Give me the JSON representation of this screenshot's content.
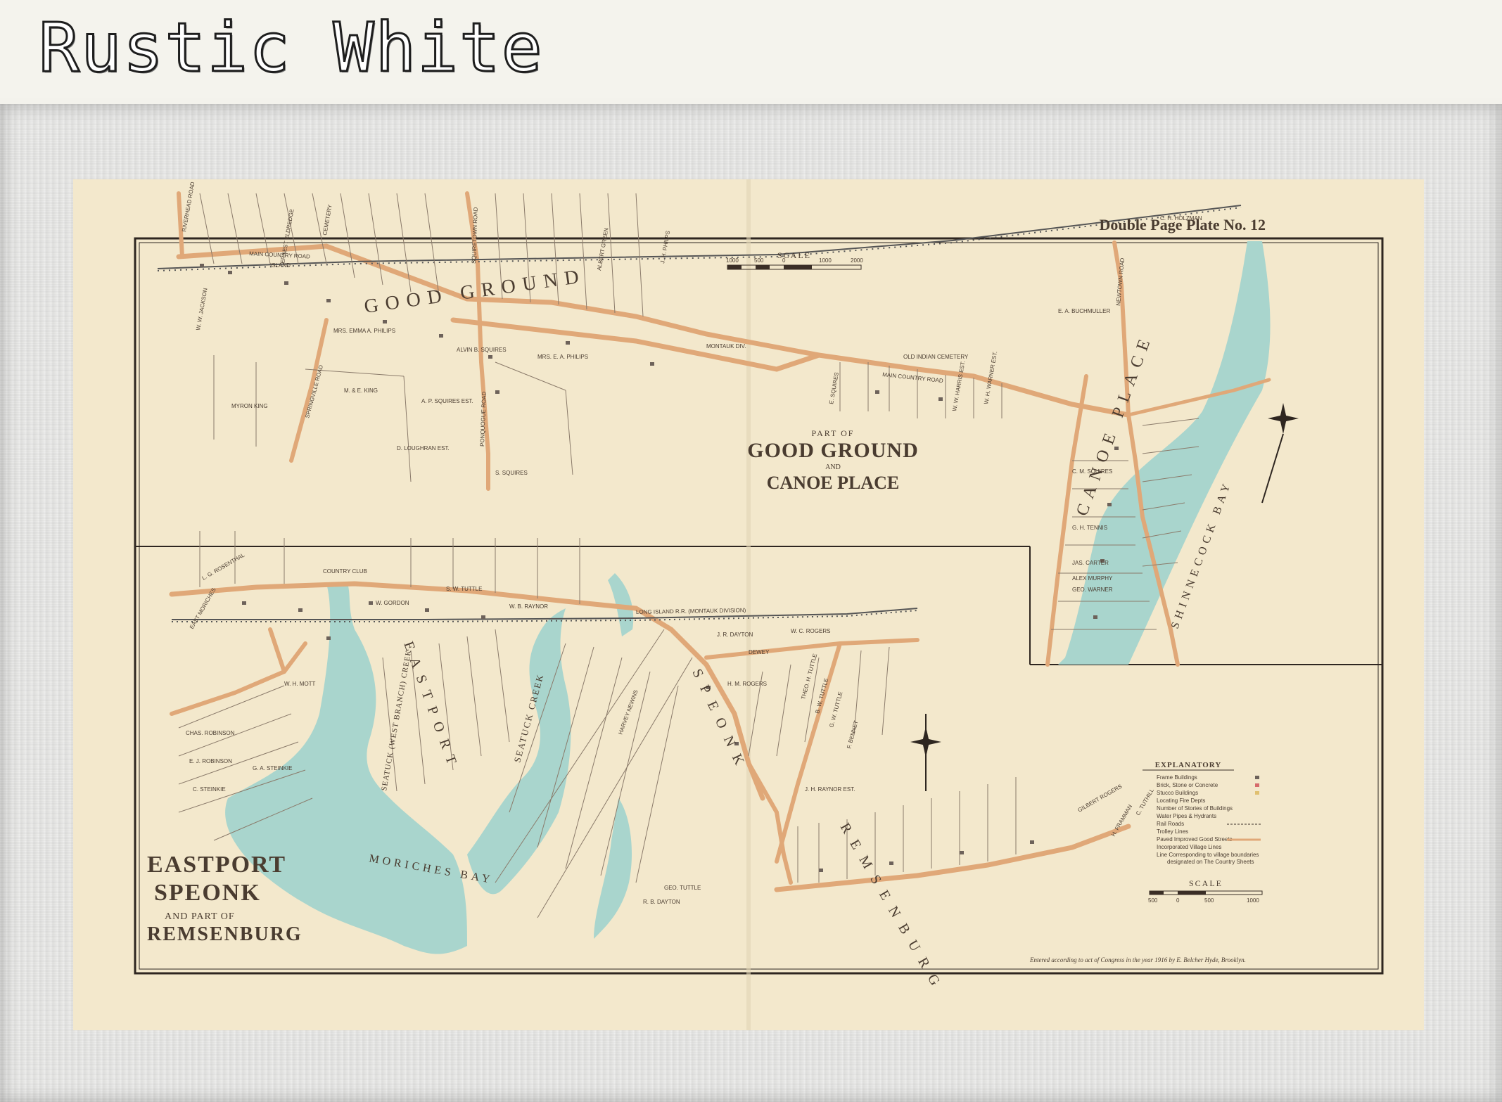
{
  "header": {
    "title": "Rustic White"
  },
  "map": {
    "plate_title": "Double Page Plate No. 12",
    "scale_label": "SCALE",
    "top_scale_ticks": [
      "1000",
      "500",
      "0",
      "1000",
      "2000"
    ],
    "bottom_scale_ticks": [
      "500",
      "0",
      "500",
      "1000"
    ],
    "part_of_label": "PART OF",
    "good_ground_title": "GOOD GROUND",
    "and_label": "AND",
    "canoe_place_title": "CANOE PLACE",
    "lower_title_1": "EASTPORT",
    "lower_title_2": "SPEONK",
    "lower_and_part_of": "AND PART OF",
    "lower_title_3": "REMSENBURG",
    "places": {
      "good_ground": "GOOD GROUND",
      "canoe_place": "CANOE PLACE",
      "shinnecock_bay": "SHINNECOCK BAY",
      "moriches_bay": "MORICHES BAY",
      "seatuck_creek": "SEATUCK CREEK",
      "seatuck_west": "SEATUCK (WEST BRANCH) CREEK",
      "eastport": "EASTPORT",
      "speonk": "SPEONK",
      "remsenburg": "REMSENBURG"
    },
    "roads": {
      "main_country_road": "MAIN COUNTRY ROAD",
      "riverhead_road": "RIVERHEAD ROAD",
      "squiretown_road": "SQUIRETOWN ROAD",
      "ponquogue_road": "PONQUOGUE ROAD",
      "springville_road": "SPRINGVILLE ROAD",
      "newtown_road": "NEWTOWN ROAD",
      "long_island_rr": "LONG ISLAND R.R. (MONTAUK DIVISION)",
      "island": "ISLAND",
      "montauk_div": "MONTAUK DIV.",
      "old_indian_cemetery": "OLD INDIAN CEMETERY",
      "cemetery": "CEMETERY",
      "country_club": "COUNTRY CLUB",
      "dewey": "DEWEY",
      "east_moriches": "EAST MORICHES"
    },
    "owners_top": [
      "W. W. JACKSON",
      "MRS. EMMA A. PHILIPS",
      "ALVIN B. SQUIRES",
      "MYRON KING",
      "M. & E. KING",
      "A. P. SQUIRES EST.",
      "D. LOUGHRAN EST.",
      "E. A. BUCHMULLER",
      "C. H. HOLZMAN",
      "W. W. HARRIS EST.",
      "W. H. WARNER EST.",
      "C. M. SQUIRES",
      "G. H. TENNIS",
      "GEO. WARNER",
      "JAS. CARTER",
      "ALEX MURPHY",
      "MRS. E. A. PHILIPS",
      "J. H. PHILPS",
      "ALBERT GREEN",
      "ERNEST ELDREDGE",
      "S. SQUIRES",
      "E. SQUIRES"
    ],
    "owners_bottom": [
      "L. G. ROSENTHAL",
      "W. H. MOTT",
      "CHAS. ROBINSON",
      "E. J. ROBINSON",
      "C. STEINKIE",
      "G. A. STEINKIE",
      "J. R. DAYTON",
      "W. C. ROGERS",
      "H. M. ROGERS",
      "HARVEY NEWINS",
      "W. B. RAYNOR",
      "S. W. TUTTLE",
      "F. BENNET",
      "G. W. TUTTLE",
      "B. W. TUTTLE",
      "THEO. H. TUTTLE",
      "GEO. TUTTLE",
      "R. B. DAYTON",
      "J. H. RAYNOR EST.",
      "W. GORDON",
      "GILBERT ROGERS",
      "H. FRAMMAN",
      "C. TUTHILL"
    ],
    "explanatory": {
      "title": "EXPLANATORY",
      "items": [
        "Frame Buildings",
        "Brick, Stone or Concrete",
        "Stucco Buildings",
        "Locating Fire Depts",
        "Number of Stories of Buildings",
        "Water Pipes & Hydrants",
        "Rail Roads",
        "Trolley Lines",
        "Paved Improved Good Streets",
        "Incorporated Village Lines",
        "Line Corresponding to village boundaries",
        "designated on The Country Sheets"
      ]
    },
    "copyright": "Entered according to act of Congress in the year 1916 by E. Belcher Hyde, Brooklyn.",
    "colors": {
      "water": "#a9d5cd",
      "road": "#e0a878",
      "paper": "#f3e8cc",
      "ink": "#3a2e26"
    }
  }
}
